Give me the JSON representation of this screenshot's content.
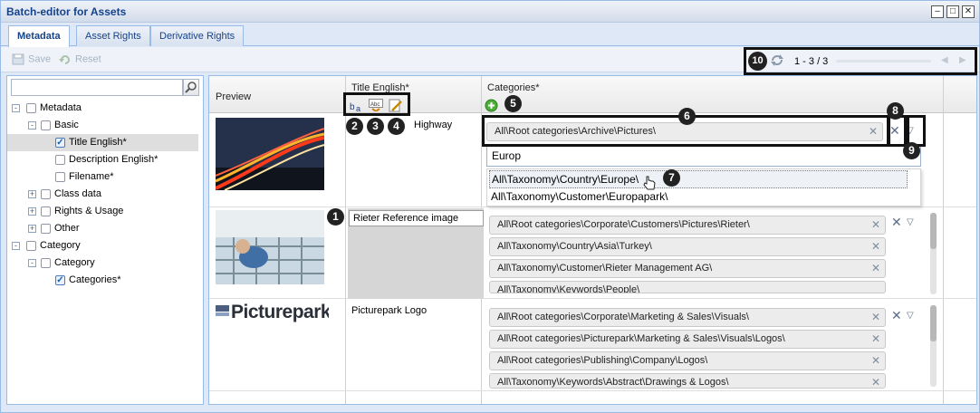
{
  "window": {
    "title": "Batch-editor for Assets",
    "controls": [
      "–",
      "□",
      "✕"
    ]
  },
  "tabs": [
    {
      "label": "Metadata",
      "active": true
    },
    {
      "label": "Asset Rights",
      "active": false
    },
    {
      "label": "Derivative Rights",
      "active": false
    }
  ],
  "toolbar": {
    "save_label": "Save",
    "reset_label": "Reset"
  },
  "pager": {
    "range": "1 - 3 / 3"
  },
  "tree": {
    "search_placeholder": "",
    "nodes": [
      {
        "label": "Metadata",
        "expander": "-",
        "checked": false
      },
      {
        "label": "Basic",
        "expander": "-",
        "checked": false
      },
      {
        "label": "Title English*",
        "expander": "",
        "checked": true,
        "selected": true
      },
      {
        "label": "Description English*",
        "expander": "",
        "checked": false
      },
      {
        "label": "Filename*",
        "expander": "",
        "checked": false
      },
      {
        "label": "Class data",
        "expander": "+",
        "checked": false
      },
      {
        "label": "Rights & Usage",
        "expander": "+",
        "checked": false
      },
      {
        "label": "Other",
        "expander": "+",
        "checked": false
      },
      {
        "label": "Category",
        "expander": "-",
        "checked": false
      },
      {
        "label": "Category",
        "expander": "-",
        "checked": false
      },
      {
        "label": "Categories*",
        "expander": "",
        "checked": true
      }
    ]
  },
  "grid": {
    "columns": {
      "preview": "Preview",
      "title": "Title English*",
      "categories": "Categories*"
    },
    "rows": [
      {
        "title": "Highway",
        "categories": [
          "All\\Root categories\\Archive\\Pictures\\"
        ]
      },
      {
        "title": "Rieter Reference image",
        "categories": [
          "All\\Root categories\\Corporate\\Customers\\Pictures\\Rieter\\",
          "All\\Taxonomy\\Country\\Asia\\Turkey\\",
          "All\\Taxonomy\\Customer\\Rieter Management AG\\",
          "All\\Taxonomy\\Keywords\\People\\"
        ]
      },
      {
        "title": "Picturepark Logo",
        "logo_text": "Picturepark",
        "categories": [
          "All\\Root categories\\Corporate\\Marketing & Sales\\Visuals\\",
          "All\\Root categories\\Picturepark\\Marketing & Sales\\Visuals\\Logos\\",
          "All\\Root categories\\Publishing\\Company\\Logos\\",
          "All\\Taxonomy\\Keywords\\Abstract\\Drawings & Logos\\"
        ]
      }
    ],
    "dropdown": {
      "input_value": "Europ",
      "items": [
        "All\\Taxonomy\\Country\\Europe\\",
        "All\\Taxonomy\\Customer\\Europapark\\"
      ]
    }
  },
  "callouts": [
    "1",
    "2",
    "3",
    "4",
    "5",
    "6",
    "7",
    "8",
    "9",
    "10"
  ],
  "colors": {
    "accent": "#15428b",
    "panel": "#dfe8f6",
    "border": "#99bbe8"
  }
}
